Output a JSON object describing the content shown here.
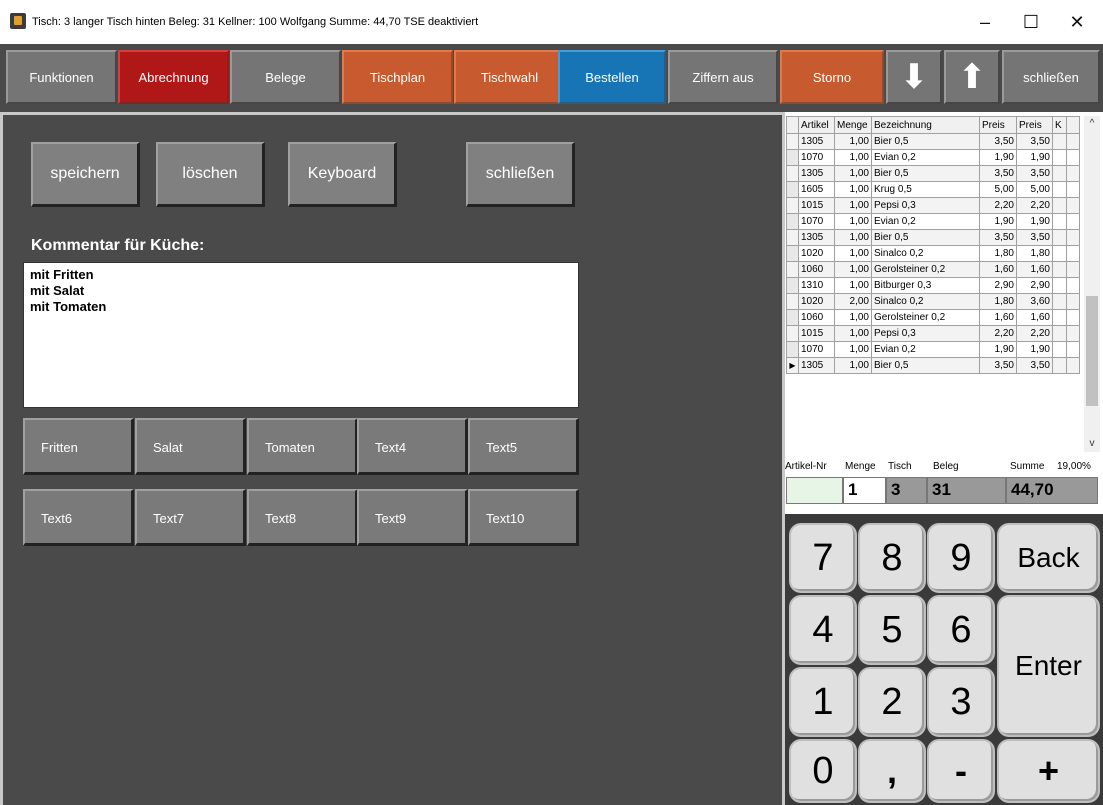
{
  "window": {
    "title": "Tisch: 3 langer Tisch hinten  Beleg: 31  Kellner: 100 Wolfgang  Summe: 44,70  TSE deaktiviert",
    "minimize": "–",
    "maximize": "☐",
    "close": "✕"
  },
  "toolbar": {
    "funktionen": "Funktionen",
    "abrechnung": "Abrechnung",
    "belege": "Belege",
    "tischplan": "Tischplan",
    "tischwahl": "Tischwahl",
    "bestellen": "Bestellen",
    "ziffern_aus": "Ziffern aus",
    "storno": "Storno",
    "down_arrow": "⬇",
    "up_arrow": "⬆",
    "schliessen": "schließen"
  },
  "comment_panel": {
    "speichern": "speichern",
    "loeschen": "löschen",
    "keyboard": "Keyboard",
    "schliessen": "schließen",
    "label": "Kommentar für Küche:",
    "lines": [
      "mit Fritten",
      "mit Salat",
      "mit Tomaten"
    ],
    "text_buttons": [
      "Fritten",
      "Salat",
      "Tomaten",
      "Text4",
      "Text5",
      "Text6",
      "Text7",
      "Text8",
      "Text9",
      "Text10"
    ]
  },
  "grid": {
    "headers": [
      "Artikel",
      "Menge",
      "Bezeichnung",
      "Preis",
      "Preis",
      "K"
    ],
    "rows": [
      [
        "1305",
        "1,00",
        "Bier 0,5",
        "3,50",
        "3,50"
      ],
      [
        "1070",
        "1,00",
        "Evian 0,2",
        "1,90",
        "1,90"
      ],
      [
        "1305",
        "1,00",
        "Bier 0,5",
        "3,50",
        "3,50"
      ],
      [
        "1605",
        "1,00",
        "Krug 0,5",
        "5,00",
        "5,00"
      ],
      [
        "1015",
        "1,00",
        "Pepsi 0,3",
        "2,20",
        "2,20"
      ],
      [
        "1070",
        "1,00",
        "Evian 0,2",
        "1,90",
        "1,90"
      ],
      [
        "1305",
        "1,00",
        "Bier 0,5",
        "3,50",
        "3,50"
      ],
      [
        "1020",
        "1,00",
        "Sinalco 0,2",
        "1,80",
        "1,80"
      ],
      [
        "1060",
        "1,00",
        "Gerolsteiner 0,2",
        "1,60",
        "1,60"
      ],
      [
        "1310",
        "1,00",
        "Bitburger 0,3",
        "2,90",
        "2,90"
      ],
      [
        "1020",
        "2,00",
        "Sinalco 0,2",
        "1,80",
        "3,60"
      ],
      [
        "1060",
        "1,00",
        "Gerolsteiner 0,2",
        "1,60",
        "1,60"
      ],
      [
        "1015",
        "1,00",
        "Pepsi 0,3",
        "2,20",
        "2,20"
      ],
      [
        "1070",
        "1,00",
        "Evian 0,2",
        "1,90",
        "1,90"
      ],
      [
        "1305",
        "1,00",
        "Bier 0,5",
        "3,50",
        "3,50"
      ]
    ],
    "scroll_up": "^",
    "scroll_down": "v",
    "current_marker": "▶"
  },
  "info": {
    "labels": {
      "artikel_nr": "Artikel-Nr",
      "menge": "Menge",
      "tisch": "Tisch",
      "beleg": "Beleg",
      "summe": "Summe",
      "mwst": "19,00%"
    },
    "values": {
      "artikel_nr": "",
      "menge": "1",
      "tisch": "3",
      "beleg": "31",
      "summe": "44,70"
    }
  },
  "keypad": {
    "k7": "7",
    "k8": "8",
    "k9": "9",
    "back": "Back",
    "k4": "4",
    "k5": "5",
    "k6": "6",
    "enter": "Enter",
    "k1": "1",
    "k2": "2",
    "k3": "3",
    "k0": "0",
    "comma": ",",
    "minus": "-",
    "plus": "+"
  },
  "colors": {
    "toolbar_bg": "#4a4a4a",
    "red": "#b01818",
    "orange": "#c75a2e",
    "blue": "#1775b5",
    "gray": "#757575"
  }
}
